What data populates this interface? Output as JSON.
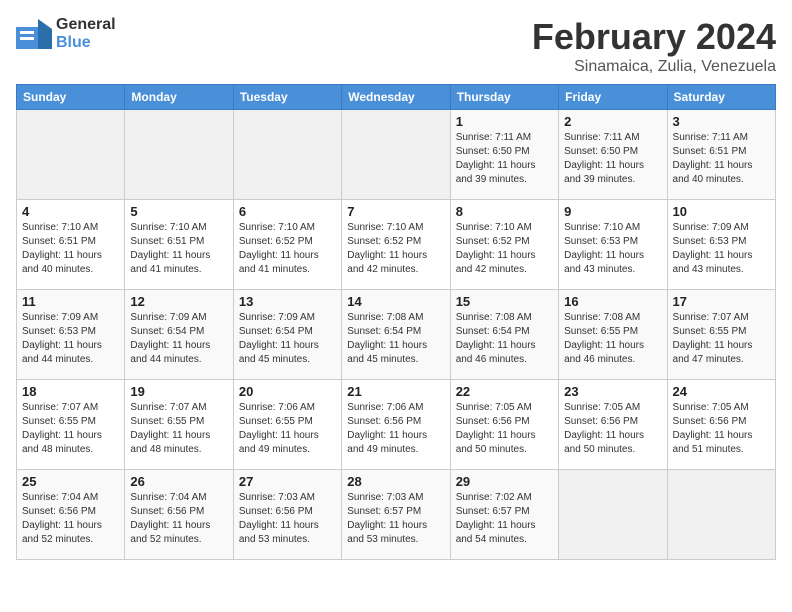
{
  "header": {
    "logo_general": "General",
    "logo_blue": "Blue",
    "month_title": "February 2024",
    "location": "Sinamaica, Zulia, Venezuela"
  },
  "calendar": {
    "days_of_week": [
      "Sunday",
      "Monday",
      "Tuesday",
      "Wednesday",
      "Thursday",
      "Friday",
      "Saturday"
    ],
    "weeks": [
      [
        {
          "day": "",
          "info": ""
        },
        {
          "day": "",
          "info": ""
        },
        {
          "day": "",
          "info": ""
        },
        {
          "day": "",
          "info": ""
        },
        {
          "day": "1",
          "info": "Sunrise: 7:11 AM\nSunset: 6:50 PM\nDaylight: 11 hours\nand 39 minutes."
        },
        {
          "day": "2",
          "info": "Sunrise: 7:11 AM\nSunset: 6:50 PM\nDaylight: 11 hours\nand 39 minutes."
        },
        {
          "day": "3",
          "info": "Sunrise: 7:11 AM\nSunset: 6:51 PM\nDaylight: 11 hours\nand 40 minutes."
        }
      ],
      [
        {
          "day": "4",
          "info": "Sunrise: 7:10 AM\nSunset: 6:51 PM\nDaylight: 11 hours\nand 40 minutes."
        },
        {
          "day": "5",
          "info": "Sunrise: 7:10 AM\nSunset: 6:51 PM\nDaylight: 11 hours\nand 41 minutes."
        },
        {
          "day": "6",
          "info": "Sunrise: 7:10 AM\nSunset: 6:52 PM\nDaylight: 11 hours\nand 41 minutes."
        },
        {
          "day": "7",
          "info": "Sunrise: 7:10 AM\nSunset: 6:52 PM\nDaylight: 11 hours\nand 42 minutes."
        },
        {
          "day": "8",
          "info": "Sunrise: 7:10 AM\nSunset: 6:52 PM\nDaylight: 11 hours\nand 42 minutes."
        },
        {
          "day": "9",
          "info": "Sunrise: 7:10 AM\nSunset: 6:53 PM\nDaylight: 11 hours\nand 43 minutes."
        },
        {
          "day": "10",
          "info": "Sunrise: 7:09 AM\nSunset: 6:53 PM\nDaylight: 11 hours\nand 43 minutes."
        }
      ],
      [
        {
          "day": "11",
          "info": "Sunrise: 7:09 AM\nSunset: 6:53 PM\nDaylight: 11 hours\nand 44 minutes."
        },
        {
          "day": "12",
          "info": "Sunrise: 7:09 AM\nSunset: 6:54 PM\nDaylight: 11 hours\nand 44 minutes."
        },
        {
          "day": "13",
          "info": "Sunrise: 7:09 AM\nSunset: 6:54 PM\nDaylight: 11 hours\nand 45 minutes."
        },
        {
          "day": "14",
          "info": "Sunrise: 7:08 AM\nSunset: 6:54 PM\nDaylight: 11 hours\nand 45 minutes."
        },
        {
          "day": "15",
          "info": "Sunrise: 7:08 AM\nSunset: 6:54 PM\nDaylight: 11 hours\nand 46 minutes."
        },
        {
          "day": "16",
          "info": "Sunrise: 7:08 AM\nSunset: 6:55 PM\nDaylight: 11 hours\nand 46 minutes."
        },
        {
          "day": "17",
          "info": "Sunrise: 7:07 AM\nSunset: 6:55 PM\nDaylight: 11 hours\nand 47 minutes."
        }
      ],
      [
        {
          "day": "18",
          "info": "Sunrise: 7:07 AM\nSunset: 6:55 PM\nDaylight: 11 hours\nand 48 minutes."
        },
        {
          "day": "19",
          "info": "Sunrise: 7:07 AM\nSunset: 6:55 PM\nDaylight: 11 hours\nand 48 minutes."
        },
        {
          "day": "20",
          "info": "Sunrise: 7:06 AM\nSunset: 6:55 PM\nDaylight: 11 hours\nand 49 minutes."
        },
        {
          "day": "21",
          "info": "Sunrise: 7:06 AM\nSunset: 6:56 PM\nDaylight: 11 hours\nand 49 minutes."
        },
        {
          "day": "22",
          "info": "Sunrise: 7:05 AM\nSunset: 6:56 PM\nDaylight: 11 hours\nand 50 minutes."
        },
        {
          "day": "23",
          "info": "Sunrise: 7:05 AM\nSunset: 6:56 PM\nDaylight: 11 hours\nand 50 minutes."
        },
        {
          "day": "24",
          "info": "Sunrise: 7:05 AM\nSunset: 6:56 PM\nDaylight: 11 hours\nand 51 minutes."
        }
      ],
      [
        {
          "day": "25",
          "info": "Sunrise: 7:04 AM\nSunset: 6:56 PM\nDaylight: 11 hours\nand 52 minutes."
        },
        {
          "day": "26",
          "info": "Sunrise: 7:04 AM\nSunset: 6:56 PM\nDaylight: 11 hours\nand 52 minutes."
        },
        {
          "day": "27",
          "info": "Sunrise: 7:03 AM\nSunset: 6:56 PM\nDaylight: 11 hours\nand 53 minutes."
        },
        {
          "day": "28",
          "info": "Sunrise: 7:03 AM\nSunset: 6:57 PM\nDaylight: 11 hours\nand 53 minutes."
        },
        {
          "day": "29",
          "info": "Sunrise: 7:02 AM\nSunset: 6:57 PM\nDaylight: 11 hours\nand 54 minutes."
        },
        {
          "day": "",
          "info": ""
        },
        {
          "day": "",
          "info": ""
        }
      ]
    ]
  }
}
